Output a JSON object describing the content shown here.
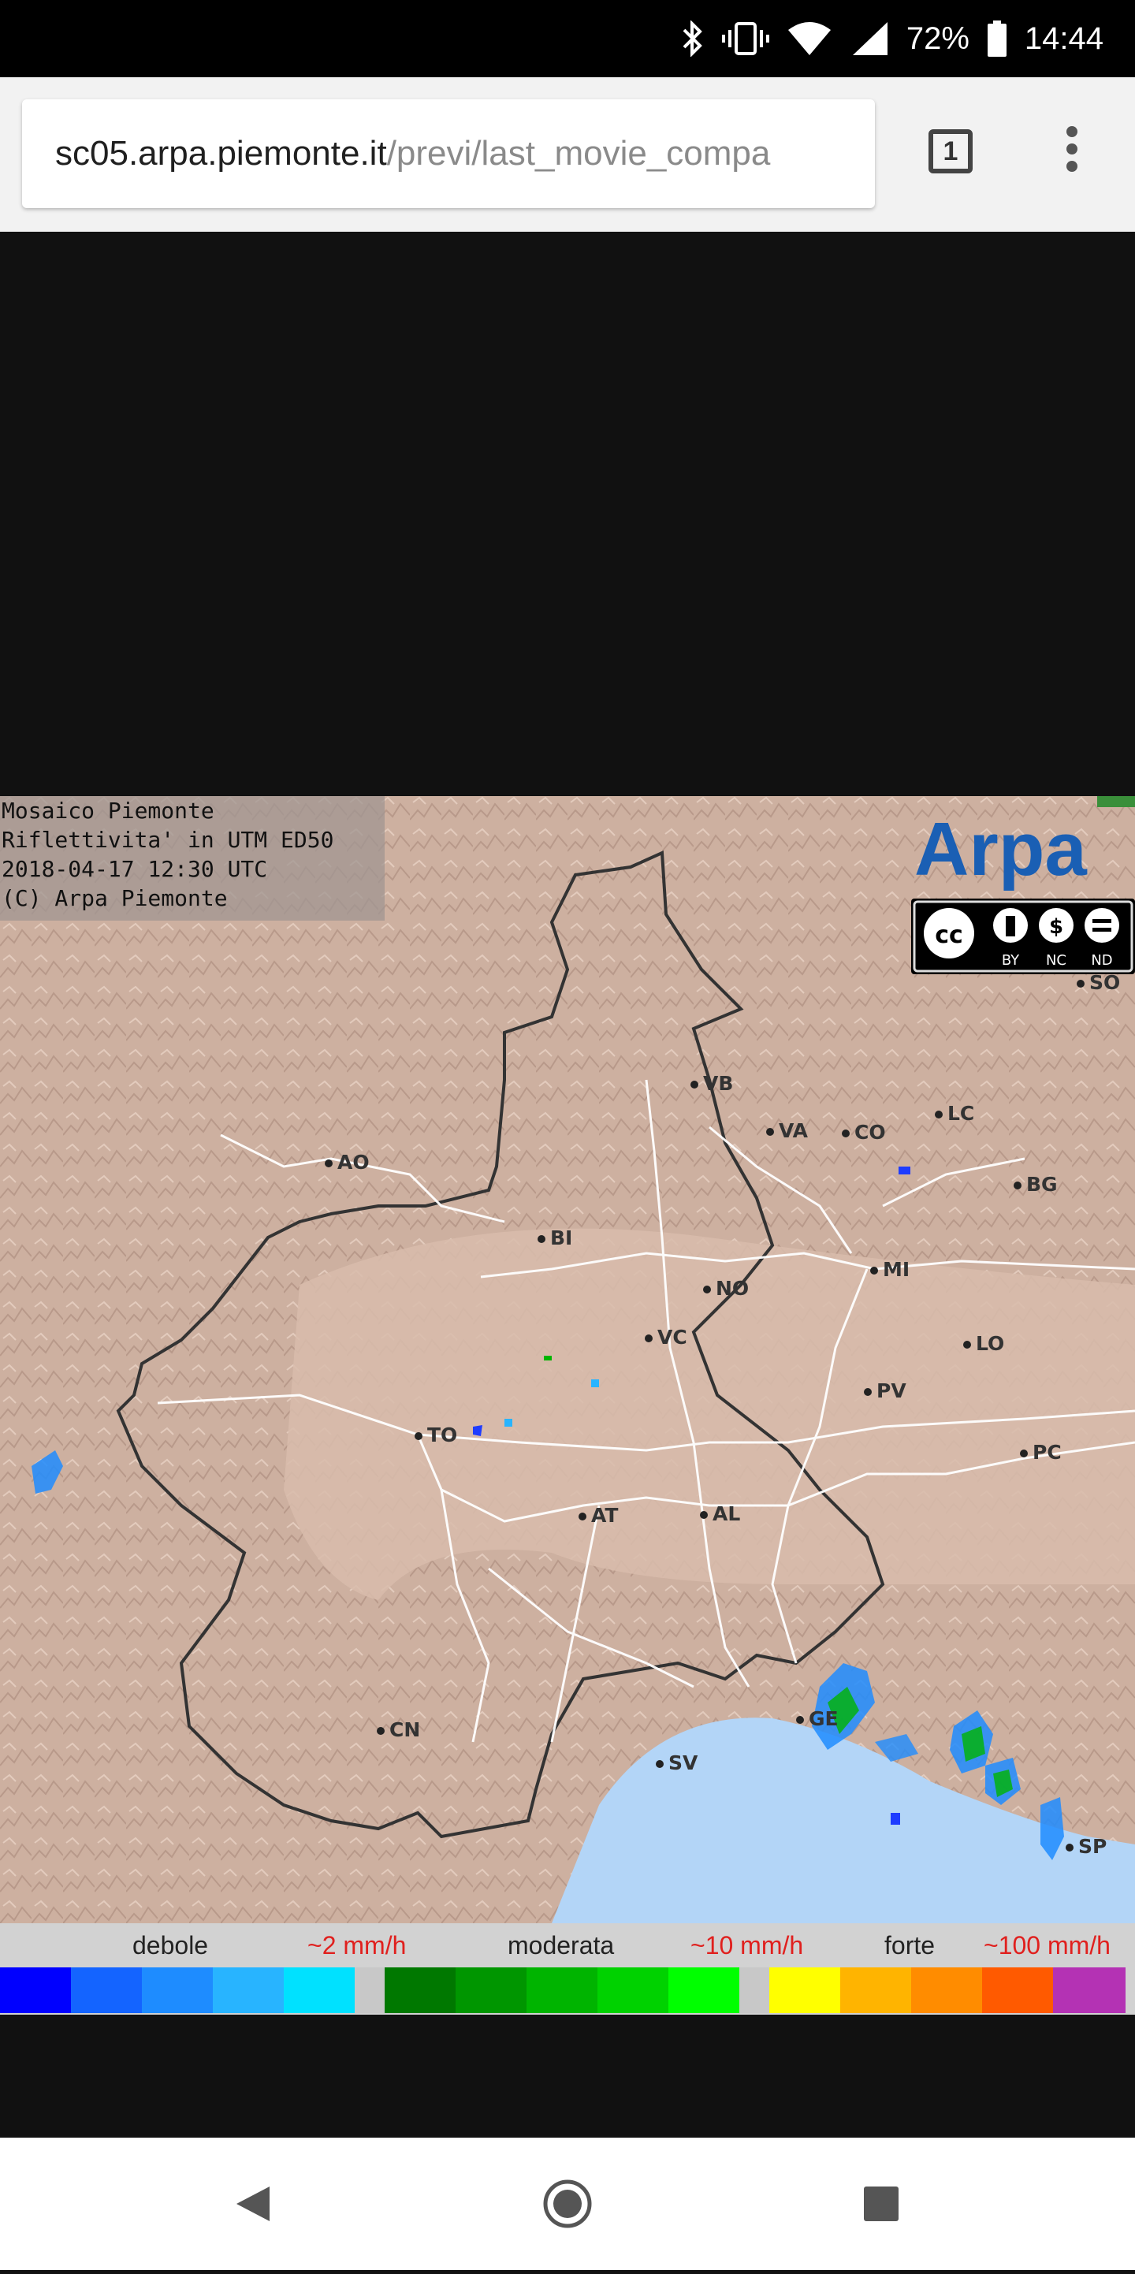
{
  "status_bar": {
    "battery": "72%",
    "time": "14:44",
    "icons": [
      "bluetooth-icon",
      "vibrate-icon",
      "wifi-icon",
      "signal-icon",
      "battery-icon"
    ]
  },
  "browser": {
    "url_host": "sc05.arpa.piemonte.it",
    "url_path": "/previ/last_movie_compa",
    "tab_count": "1"
  },
  "map": {
    "info_lines": [
      "Mosaico Piemonte",
      "Riflettivita' in UTM ED50",
      "2018-04-17 12:30 UTC",
      "(C) Arpa Piemonte"
    ],
    "logo_text": "Arpa",
    "cc_labels": [
      "BY",
      "NC",
      "ND"
    ],
    "cities": [
      "AO",
      "VB",
      "VA",
      "CO",
      "LC",
      "BG",
      "BI",
      "NO",
      "MI",
      "VC",
      "LO",
      "PV",
      "TO",
      "PC",
      "AT",
      "AL",
      "CN",
      "GE",
      "SV",
      "SP",
      "SO"
    ]
  },
  "legend": {
    "labels": {
      "debole": "debole",
      "rate_low": "~2 mm/h",
      "moderata": "moderata",
      "rate_mid": "~10 mm/h",
      "forte": "forte",
      "rate_high": "~100 mm/h"
    },
    "colors": [
      "#0000ff",
      "#1464ff",
      "#1e8cff",
      "#28b4ff",
      "#00e1ff",
      "#c8c8c8",
      "#007800",
      "#009600",
      "#00b400",
      "#00d200",
      "#00ff00",
      "#c8c8c8",
      "#ffff00",
      "#ffb400",
      "#ff8c00",
      "#ff5a00",
      "#b432b4"
    ]
  }
}
